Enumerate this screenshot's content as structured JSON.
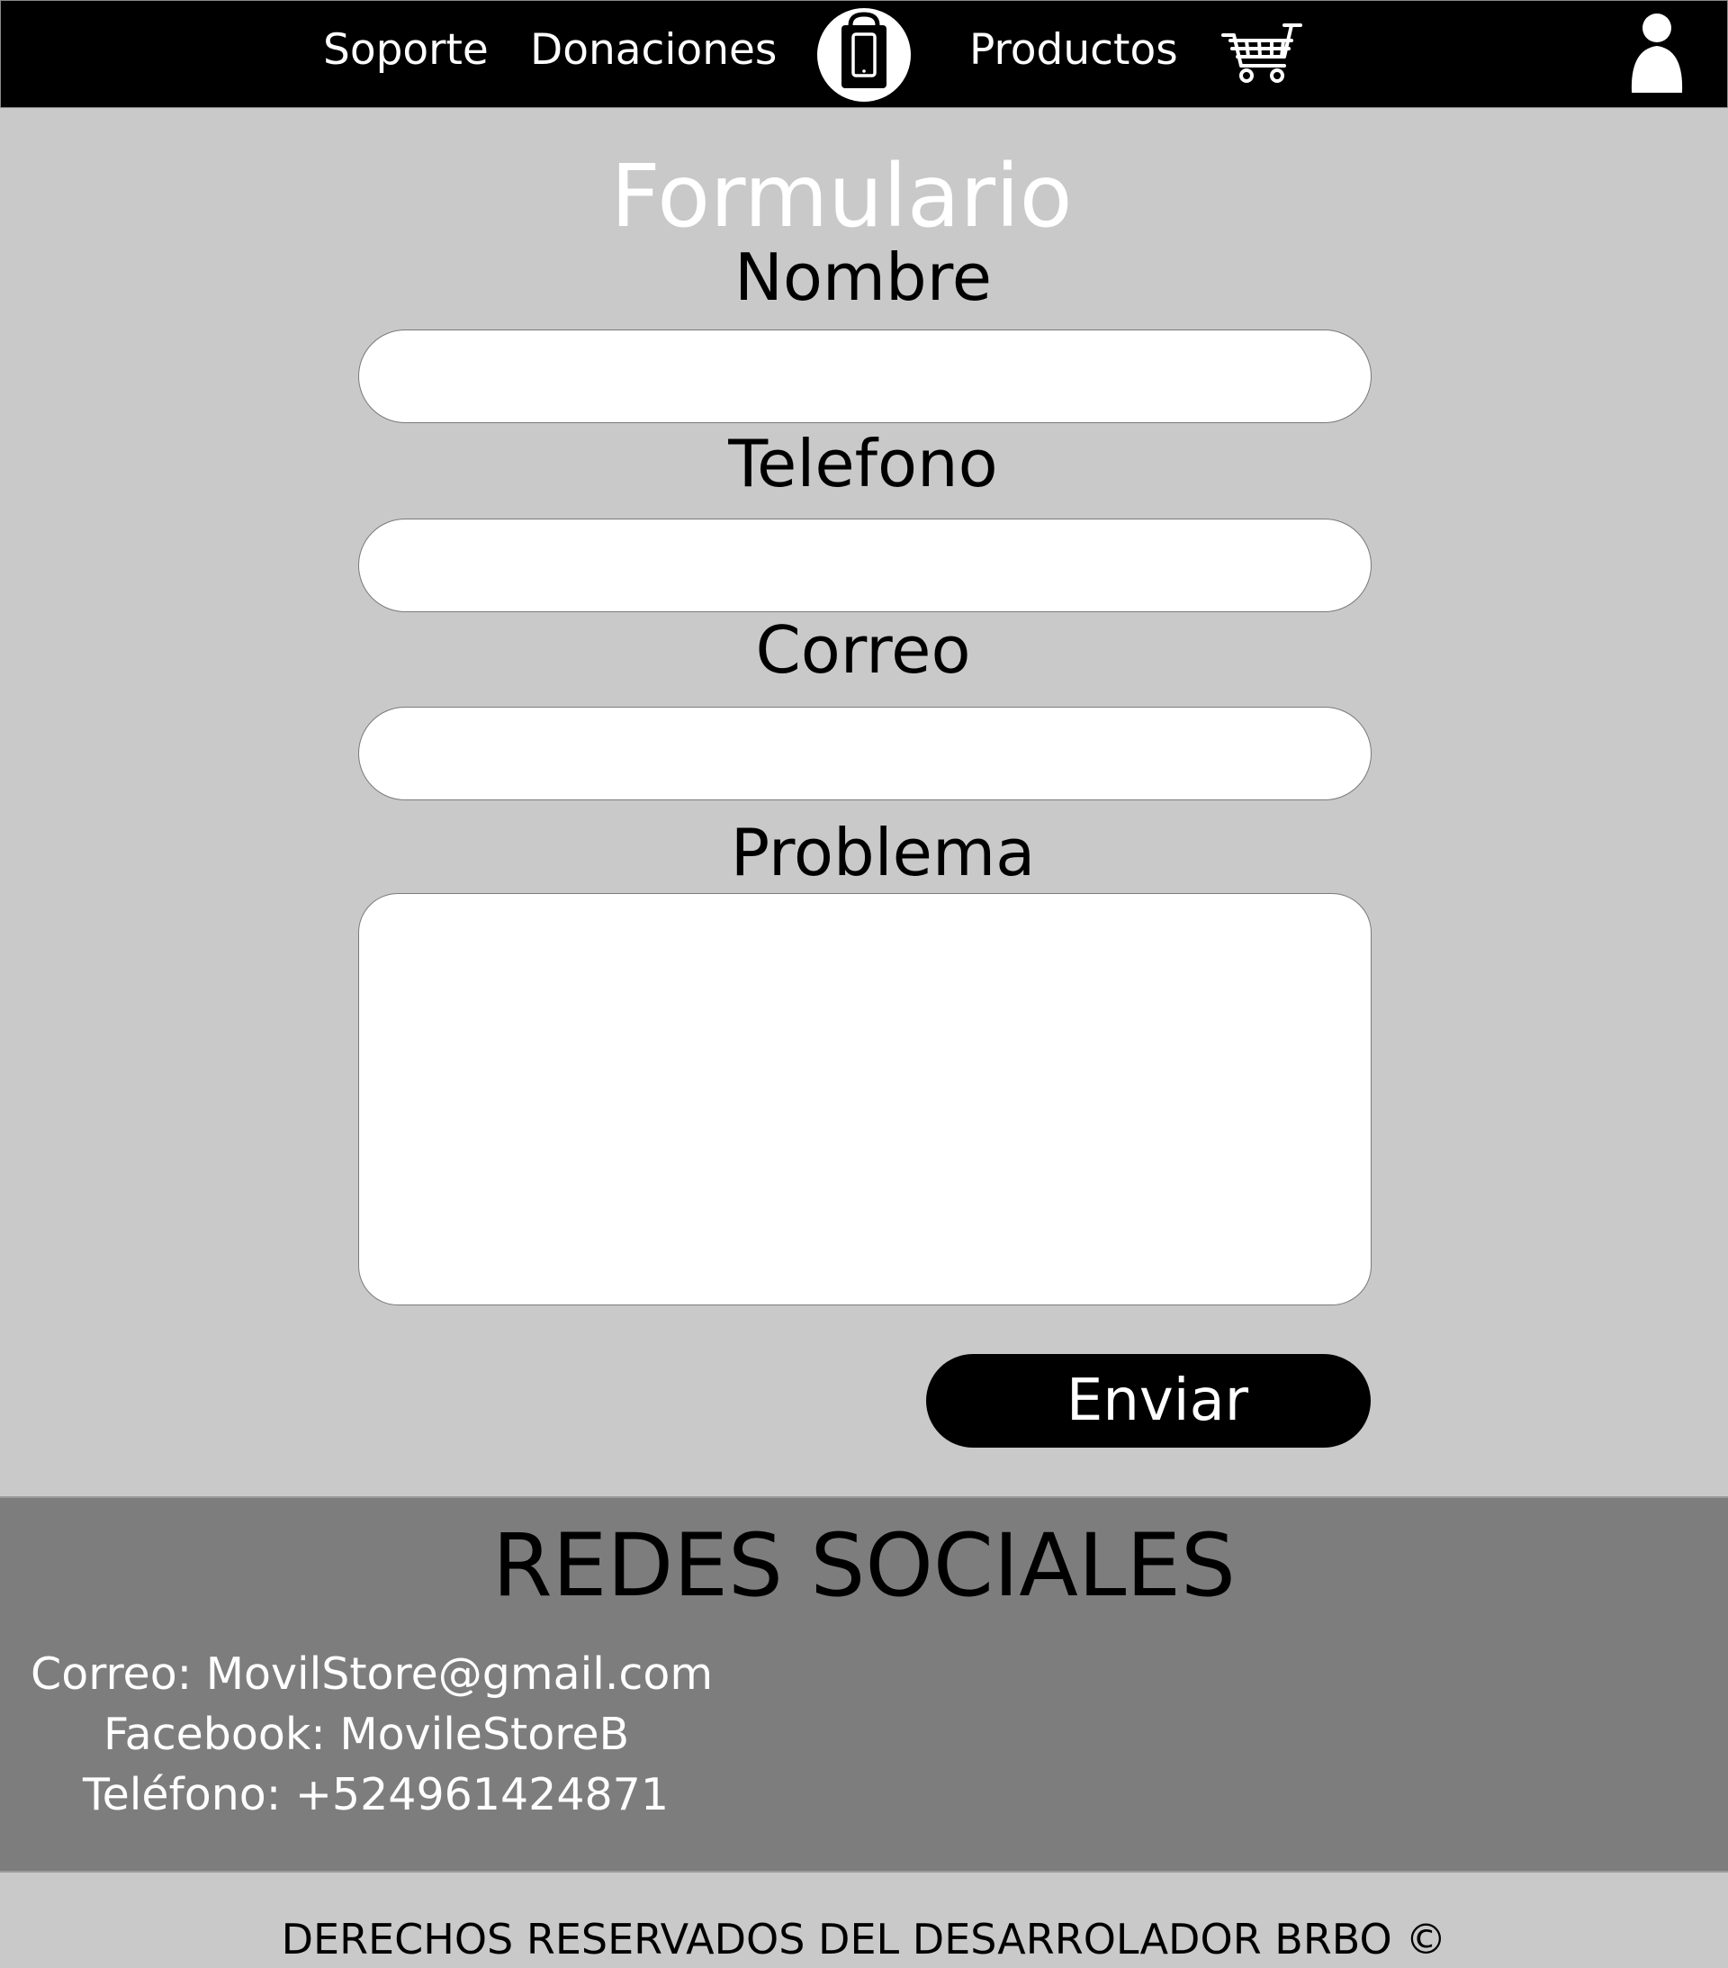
{
  "nav": {
    "links": [
      "Soporte",
      "Donaciones",
      "Productos"
    ],
    "logo_icon": "phone-bag-logo-icon",
    "cart_icon": "shopping-cart-icon",
    "user_icon": "user-icon"
  },
  "form": {
    "title": "Formulario",
    "labels": {
      "nombre": "Nombre",
      "telefono": "Telefono",
      "correo": "Correo",
      "problema": "Problema"
    },
    "values": {
      "nombre": "",
      "telefono": "",
      "correo": "",
      "problema": ""
    },
    "submit_label": "Enviar"
  },
  "social": {
    "title": "REDES SOCIALES",
    "correo": "Correo: MovilStore@gmail.com",
    "facebook": "Facebook: MovileStoreB",
    "telefono": "Teléfono: +524961424871"
  },
  "footer": {
    "copyright": "DERECHOS RESERVADOS DEL DESARROLADOR BRBO ©"
  },
  "colors": {
    "navbar": "#000000",
    "page_bg": "#c9c9c9",
    "social_bg": "#7d7d7d",
    "button": "#000000"
  }
}
